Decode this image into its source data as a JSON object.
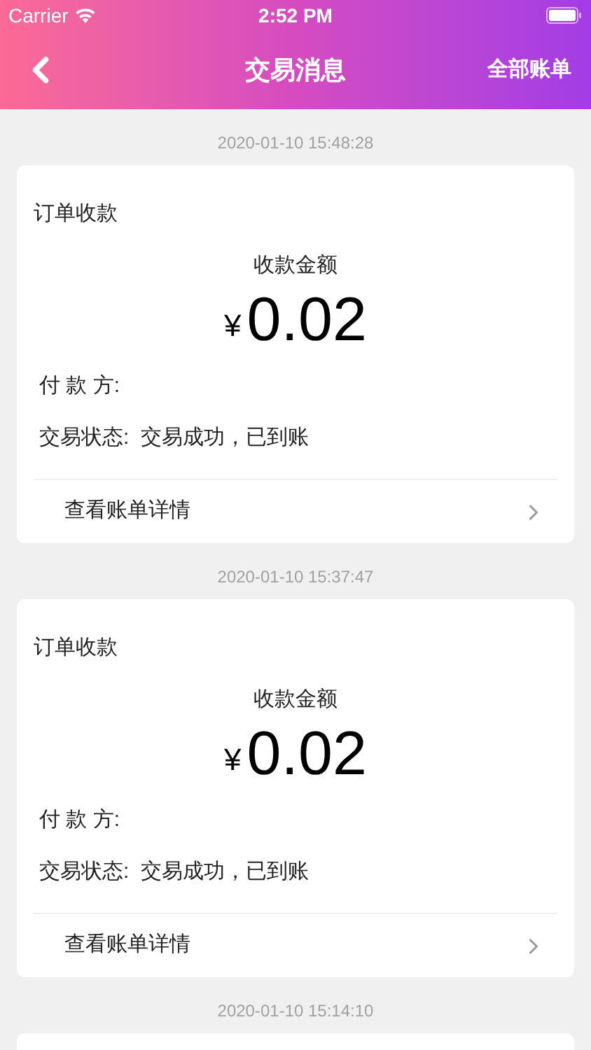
{
  "status_bar": {
    "carrier": "Carrier",
    "time": "2:52 PM"
  },
  "nav": {
    "title": "交易消息",
    "action": "全部账单"
  },
  "messages": [
    {
      "time": "2020-01-10 15:48:28",
      "title": "订单收款",
      "amount_label": "收款金额",
      "currency": "¥",
      "amount": "0.02",
      "payer": "付 款 方:",
      "status": "交易状态:  交易成功，已到账",
      "link": "查看账单详情"
    },
    {
      "time": "2020-01-10 15:37:47",
      "title": "订单收款",
      "amount_label": "收款金额",
      "currency": "¥",
      "amount": "0.02",
      "payer": "付 款 方:",
      "status": "交易状态:  交易成功，已到账",
      "link": "查看账单详情"
    },
    {
      "time": "2020-01-10 15:14:10"
    }
  ]
}
